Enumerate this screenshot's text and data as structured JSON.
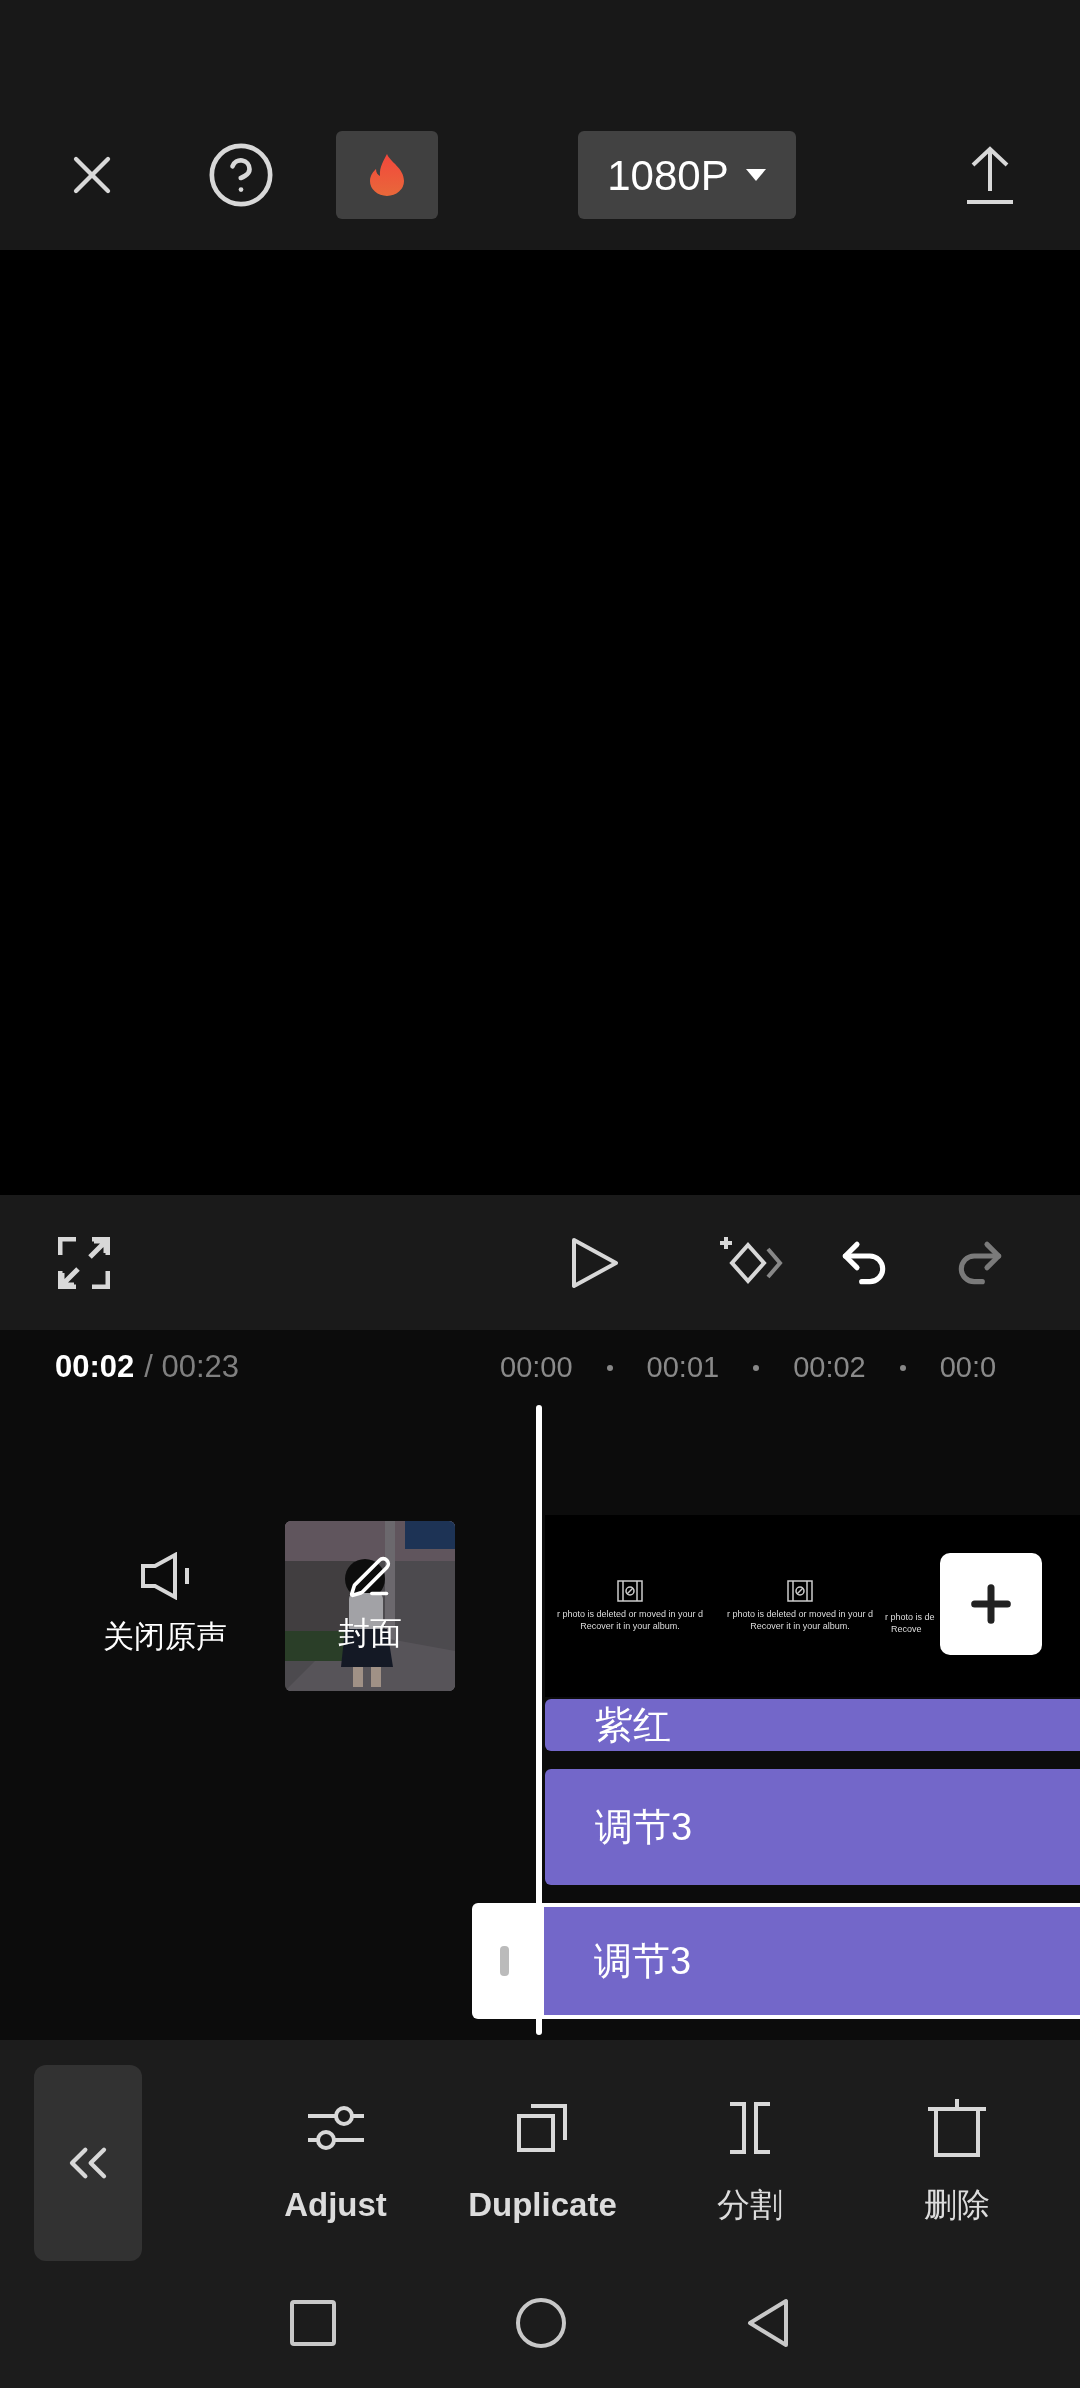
{
  "top_bar": {
    "resolution": "1080P"
  },
  "time": {
    "current": "00:02",
    "total": "/ 00:23"
  },
  "ruler": [
    "00:00",
    "00:01",
    "00:02",
    "00:0"
  ],
  "mute_label": "关闭原声",
  "cover_label": "封面",
  "frames": [
    {
      "line1": "r photo is deleted or moved in your d",
      "line2": "Recover it in your album."
    },
    {
      "line1": "r photo is deleted or moved in your d",
      "line2": "Recover it in your album."
    },
    {
      "line1": "r photo is de",
      "line2": "Recove"
    }
  ],
  "tracks": [
    {
      "label": "紫红",
      "selected": false
    },
    {
      "label": "调节3",
      "selected": false
    },
    {
      "label": "调节3",
      "selected": true
    }
  ],
  "toolbar": [
    {
      "kind": "adjust",
      "label": "Adjust"
    },
    {
      "kind": "duplicate",
      "label": "Duplicate"
    },
    {
      "kind": "split",
      "label": "分割"
    },
    {
      "kind": "delete",
      "label": "删除"
    }
  ]
}
